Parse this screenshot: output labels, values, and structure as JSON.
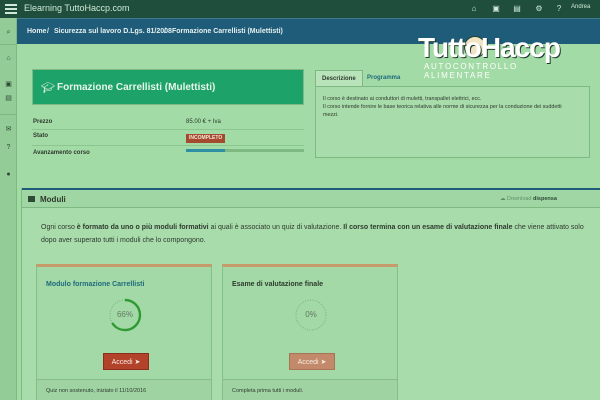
{
  "topbar": {
    "app_title": "Elearning TuttoHaccp.com",
    "icons": [
      "home-icon",
      "cart-icon",
      "book-icon",
      "settings-icon",
      "help-icon"
    ],
    "user_label": "Andrea"
  },
  "sidebar": {
    "icons": [
      "search-icon",
      "home-icon",
      "archive-icon",
      "book-icon",
      "mail-icon",
      "help-icon",
      "user-icon"
    ]
  },
  "breadcrumb": [
    "Home",
    "/",
    "Sicurezza sul lavoro D.Lgs. 81/2008",
    "/",
    "Formazione Carrellisti (Mulettisti)"
  ],
  "logo": {
    "main": "TuttoHaccp",
    "sub": "AUTOCONTROLLO ALIMENTARE"
  },
  "course": {
    "title": "Formazione Carrellisti (Mulettisti)",
    "price_label": "Prezzo",
    "price_value": "85.00 € + Iva",
    "status_label": "Stato",
    "status_value": "INCOMPLETO",
    "progress_label": "Avanzamento corso",
    "progress": 0.33
  },
  "tabs": {
    "items": [
      "Descrizione",
      "Programma"
    ],
    "active": "Descrizione",
    "description_lines": [
      "Il corso è destinato ai conduttori di muletti, transpallet elettrici, ecc.",
      "Il corso intende fornire le base teorica relativa alle norme di sicurezza per la conduzione dei suddetti",
      "mezzi."
    ]
  },
  "modules": {
    "title": "Moduli",
    "download_label": "Download",
    "download_strong": "dispensa",
    "intro_part1": "Ogni corso ",
    "intro_bold1": "è formato da uno o più moduli formativi",
    "intro_part2": " ai quali è associato un quiz di valutazione. ",
    "intro_bold2": "Il corso termina con un esame di valutazione finale",
    "intro_part3": " che viene attivato solo dopo aver superato tutti i moduli che lo compongono.",
    "cards": [
      {
        "title": "Modulo formazione Carrellisti",
        "percent_label": "66%",
        "percent": 0.66,
        "button": "Accedi",
        "footer": "Quiz non sostenuto, iniziato il 11/10/2016"
      },
      {
        "title": "Esame di valutazione finale",
        "percent_label": "0%",
        "percent": 0,
        "button": "Accedi",
        "footer": "Completa prima tutti i moduli."
      }
    ]
  },
  "colors": {
    "accent_teal": "#1da36a",
    "breadcrumb_bg": "#1f5c79",
    "status_badge": "#a54a2e",
    "button_active": "#b2422a",
    "ring_progress": "#2f9a33"
  }
}
